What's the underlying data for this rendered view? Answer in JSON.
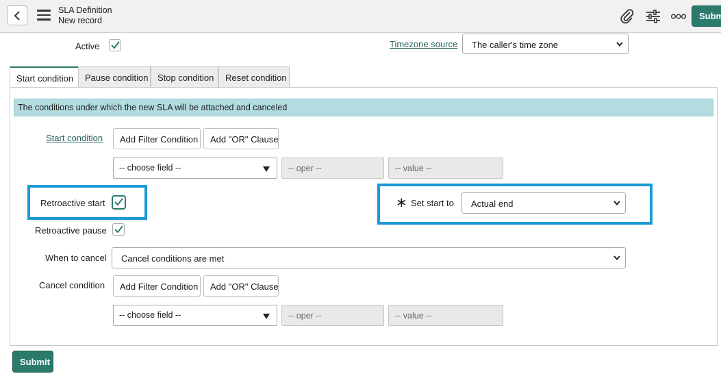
{
  "header": {
    "title": "SLA Definition",
    "subtitle": "New record",
    "submit_label": "Submit"
  },
  "top_fields": {
    "active_label": "Active",
    "active_checked": true,
    "timezone_label": "Timezone source",
    "timezone_value": "The caller's time zone"
  },
  "tabs": [
    {
      "label": "Start condition",
      "active": true
    },
    {
      "label": "Pause condition",
      "active": false
    },
    {
      "label": "Stop condition",
      "active": false
    },
    {
      "label": "Reset condition",
      "active": false
    }
  ],
  "info_text": "The conditions under which the new SLA will be attached and canceled",
  "start_condition": {
    "label": "Start condition",
    "add_filter_label": "Add Filter Condition",
    "add_or_label": "Add \"OR\" Clause",
    "field_placeholder": "-- choose field --",
    "oper_placeholder": "-- oper --",
    "value_placeholder": "-- value --"
  },
  "retroactive_start": {
    "label": "Retroactive start",
    "checked": true
  },
  "set_start_to": {
    "required_marker": "∗",
    "label": "Set start to",
    "value": "Actual end"
  },
  "retroactive_pause": {
    "label": "Retroactive pause",
    "checked": true
  },
  "when_to_cancel": {
    "label": "When to cancel",
    "value": "Cancel conditions are met"
  },
  "cancel_condition": {
    "label": "Cancel condition",
    "add_filter_label": "Add Filter Condition",
    "add_or_label": "Add \"OR\" Clause",
    "field_placeholder": "-- choose field --",
    "oper_placeholder": "-- oper --",
    "value_placeholder": "-- value --"
  },
  "footer": {
    "submit_label": "Submit"
  },
  "icons": {
    "back": "chevron-left-icon",
    "menu": "hamburger-menu-icon",
    "attach": "paperclip-icon",
    "settings": "sliders-icon",
    "more": "more-options-icon"
  },
  "colors": {
    "accent": "#2b7a6b",
    "info_bar": "#b3dce0",
    "highlight": "#1a9ad6",
    "link": "#29625a"
  }
}
